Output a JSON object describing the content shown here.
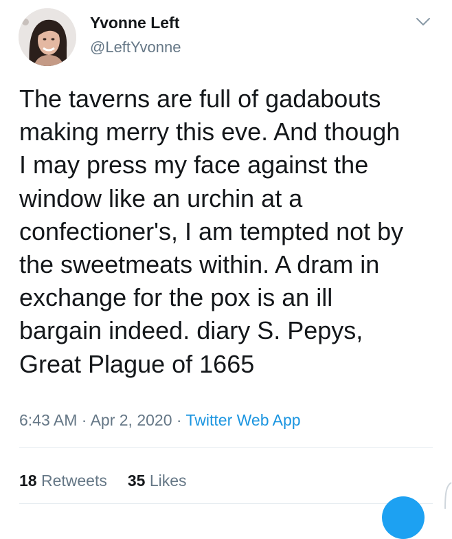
{
  "user": {
    "display_name": "Yvonne Left",
    "handle": "@LeftYvonne"
  },
  "tweet": {
    "text": "The taverns are full of gadabouts\nmaking merry this eve. And though\nI may press my face against the\nwindow like an urchin at a\nconfectioner's, I am tempted not by\nthe sweetmeats within. A dram in\nexchange for the pox is an ill\nbargain indeed. diary S. Pepys,\nGreat Plague of 1665",
    "time": "6:43 AM",
    "separator": " · ",
    "date": "Apr 2, 2020",
    "source": "Twitter Web App"
  },
  "stats": {
    "retweets_count": "18",
    "retweets_label": "Retweets",
    "likes_count": "35",
    "likes_label": "Likes"
  },
  "icons": {
    "menu": "chevron-down-icon"
  },
  "colors": {
    "text": "#14171a",
    "secondary": "#657786",
    "link": "#1b95e0",
    "divider": "#e6ecf0"
  }
}
